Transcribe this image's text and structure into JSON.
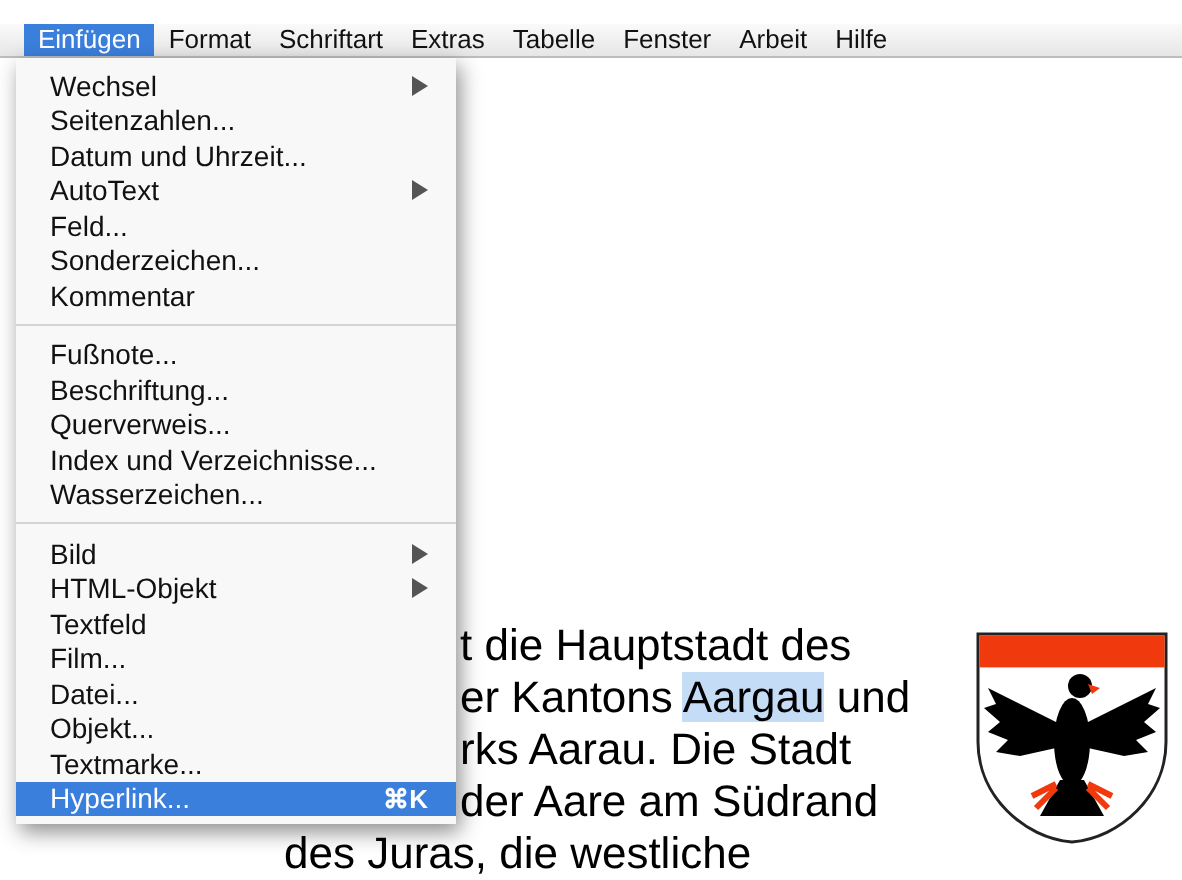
{
  "menu_bar": [
    {
      "label": "Einfügen",
      "selected": true
    },
    {
      "label": "Format",
      "selected": false
    },
    {
      "label": "Schriftart",
      "selected": false
    },
    {
      "label": "Extras",
      "selected": false
    },
    {
      "label": "Tabelle",
      "selected": false
    },
    {
      "label": "Fenster",
      "selected": false
    },
    {
      "label": "Arbeit",
      "selected": false
    },
    {
      "label": "Hilfe",
      "selected": false
    }
  ],
  "menu": {
    "items": [
      {
        "kind": "item",
        "label": "Wechsel",
        "submenu": true,
        "selected": false
      },
      {
        "kind": "item",
        "label": "Seitenzahlen...",
        "submenu": false,
        "selected": false
      },
      {
        "kind": "item",
        "label": "Datum und Uhrzeit...",
        "submenu": false,
        "selected": false
      },
      {
        "kind": "item",
        "label": "AutoText",
        "submenu": true,
        "selected": false
      },
      {
        "kind": "item",
        "label": "Feld...",
        "submenu": false,
        "selected": false
      },
      {
        "kind": "item",
        "label": "Sonderzeichen...",
        "submenu": false,
        "selected": false
      },
      {
        "kind": "item",
        "label": "Kommentar",
        "submenu": false,
        "selected": false
      },
      {
        "kind": "separator"
      },
      {
        "kind": "item",
        "label": "Fußnote...",
        "submenu": false,
        "selected": false
      },
      {
        "kind": "item",
        "label": "Beschriftung...",
        "submenu": false,
        "selected": false
      },
      {
        "kind": "item",
        "label": "Querverweis...",
        "submenu": false,
        "selected": false
      },
      {
        "kind": "item",
        "label": "Index und Verzeichnisse...",
        "submenu": false,
        "selected": false
      },
      {
        "kind": "item",
        "label": "Wasserzeichen...",
        "submenu": false,
        "selected": false
      },
      {
        "kind": "separator"
      },
      {
        "kind": "item",
        "label": "Bild",
        "submenu": true,
        "selected": false
      },
      {
        "kind": "item",
        "label": "HTML-Objekt",
        "submenu": true,
        "selected": false
      },
      {
        "kind": "item",
        "label": "Textfeld",
        "submenu": false,
        "selected": false
      },
      {
        "kind": "item",
        "label": "Film...",
        "submenu": false,
        "selected": false
      },
      {
        "kind": "item",
        "label": "Datei...",
        "submenu": false,
        "selected": false
      },
      {
        "kind": "item",
        "label": "Objekt...",
        "submenu": false,
        "selected": false
      },
      {
        "kind": "item",
        "label": "Textmarke...",
        "submenu": false,
        "selected": false
      },
      {
        "kind": "item",
        "label": "Hyperlink...",
        "shortcut": "⌘K",
        "submenu": false,
        "selected": true
      }
    ]
  },
  "document": {
    "lines": [
      {
        "covered": true,
        "segments": [
          {
            "text": "t die Hauptstadt des",
            "selected": false
          }
        ]
      },
      {
        "covered": true,
        "segments": [
          {
            "text": "er Kantons ",
            "selected": false
          },
          {
            "text": "Aargau",
            "selected": true
          },
          {
            "text": " und",
            "selected": false
          }
        ]
      },
      {
        "covered": true,
        "segments": [
          {
            "text": "rks Aarau. Die Stadt",
            "selected": false
          }
        ]
      },
      {
        "covered": true,
        "segments": [
          {
            "text": "der Aare am Südrand",
            "selected": false
          }
        ]
      },
      {
        "covered": false,
        "segments": [
          {
            "text": "des Juras, die westliche",
            "selected": false
          }
        ]
      }
    ]
  }
}
